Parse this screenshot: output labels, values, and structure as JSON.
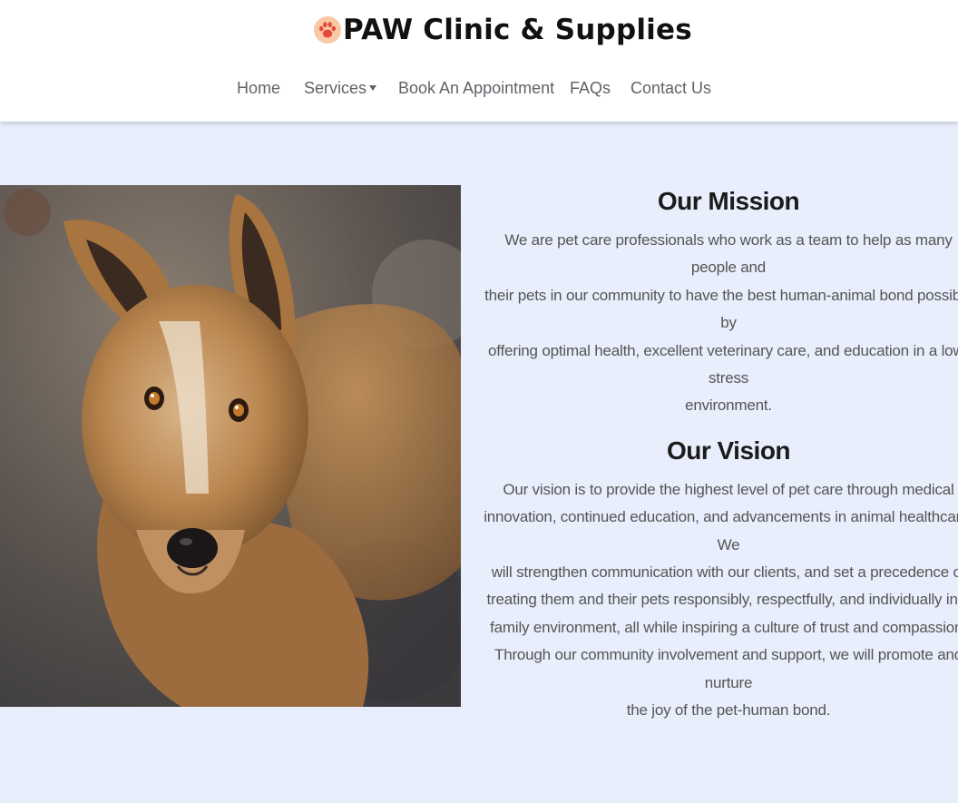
{
  "header": {
    "brand": "PAW Clinic & Supplies",
    "brand_icon": "paw-icon",
    "brand_icon_color": "#e24a3b",
    "brand_badge_color": "#f9c9a6"
  },
  "nav": {
    "items": [
      {
        "label": "Home"
      },
      {
        "label": "Services",
        "has_dropdown": true
      },
      {
        "label": "Book An Appointment"
      },
      {
        "label": "FAQs"
      },
      {
        "label": "Contact Us"
      }
    ]
  },
  "main": {
    "background": "#e8eefc",
    "photo_subject": "dog-photo",
    "mission": {
      "title": "Our Mission",
      "body": "We are pet care professionals who work as a team to help as many people and\ntheir pets in our community to have the best human-animal bond possible by\noffering optimal health, excellent veterinary care, and education in a low-stress\nenvironment."
    },
    "vision": {
      "title": "Our Vision",
      "body": "Our vision is to provide the highest level of pet care through medical\ninnovation, continued education, and advancements in animal healthcare. We\nwill strengthen communication with our clients, and set a precedence of\ntreating them and their pets responsibly, respectfully, and individually in a\nfamily environment, all while inspiring a culture of trust and compassion.\nThrough our community involvement and support, we will promote and nurture\nthe joy of the pet-human bond."
    }
  }
}
